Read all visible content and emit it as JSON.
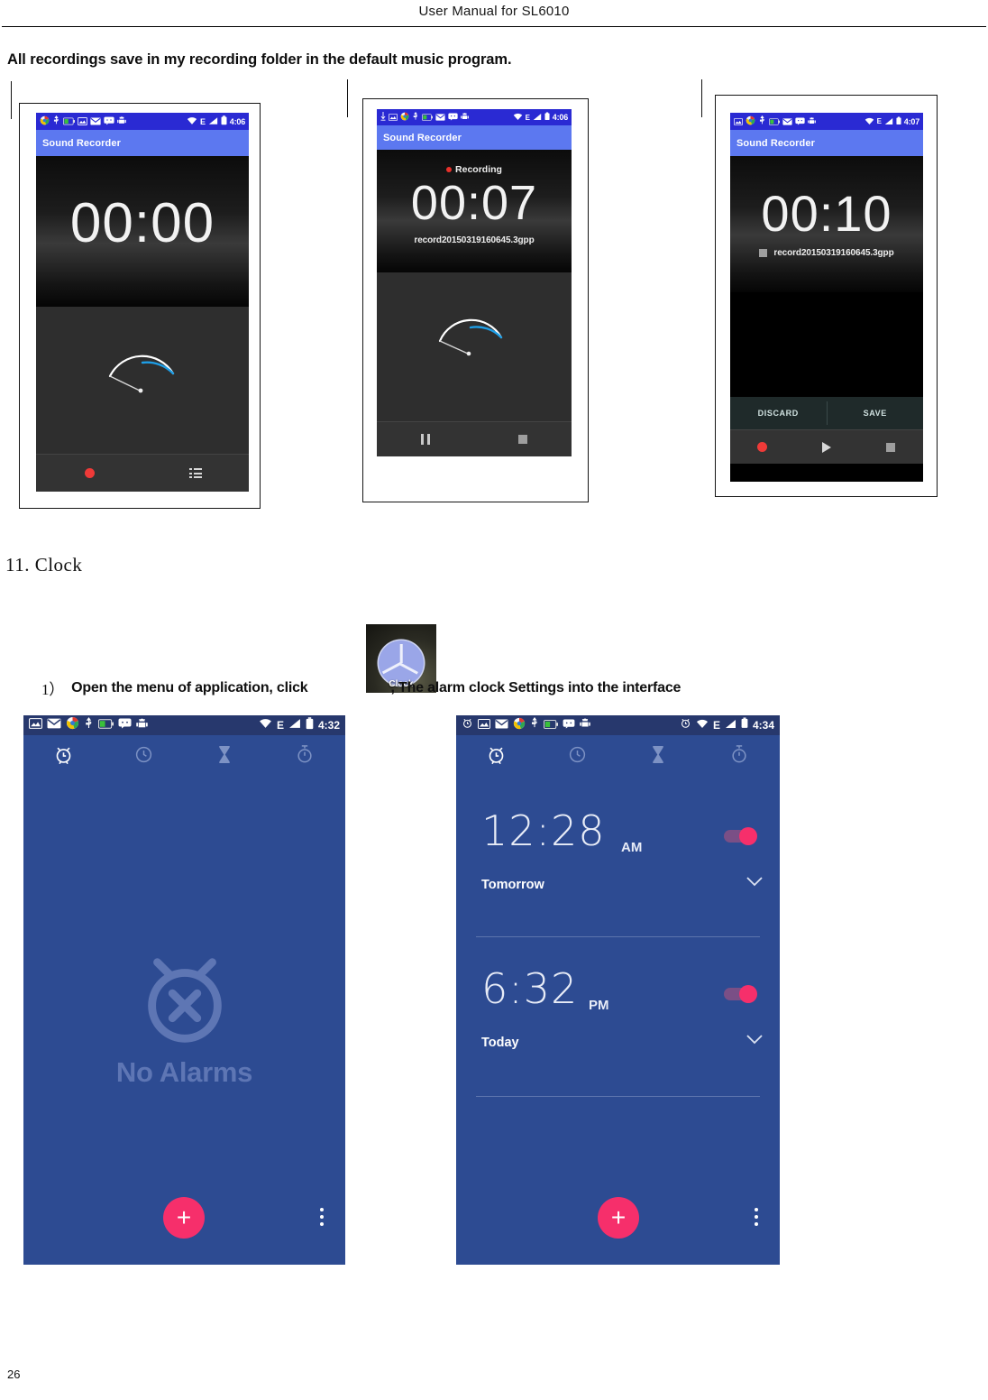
{
  "document": {
    "header_title": "User Manual for SL6010",
    "page_number": "26",
    "intro_line": "All recordings save in my recording folder in the default music program.",
    "section_heading": "11. Clock",
    "step": {
      "number": "1）",
      "text_before": "Open the menu of application, click",
      "text_after": ", The alarm clock Settings into the interface"
    },
    "clock_app_icon": {
      "label": "Clock",
      "icon": "clock-app-icon"
    }
  },
  "colors": {
    "status_bar_recorder": "#2a2ad3",
    "app_bar_recorder": "#5c78f0",
    "clock_background": "#2d4b92",
    "clock_status_bar": "#27386d",
    "accent_pink": "#f62f6b",
    "toggle_track": "#7a4f86",
    "record_red": "#ef3a38"
  },
  "recorder_screens": [
    {
      "name": "recorder-idle",
      "status_bar": {
        "time": "4:06",
        "left_icons": [
          "browser-icon",
          "usb-icon",
          "battery-charging-icon",
          "screenshot-icon",
          "email-icon",
          "sms-icon",
          "android-debug-icon"
        ],
        "right_icons": [
          "wifi-icon",
          "edge-network-icon",
          "signal-icon",
          "battery-icon"
        ]
      },
      "app_bar_title": "Sound Recorder",
      "timer": "00:00",
      "status_label": "",
      "file_name": "",
      "meter": "vu-meter",
      "bottom_buttons": [
        "record-button",
        "recording-list-button"
      ]
    },
    {
      "name": "recorder-recording",
      "status_bar": {
        "time": "4:06",
        "left_icons": [
          "download-icon",
          "screenshot-icon",
          "browser-icon",
          "usb-icon",
          "battery-charging-icon",
          "email-icon",
          "sms-icon",
          "android-debug-icon"
        ],
        "right_icons": [
          "wifi-icon",
          "edge-network-icon",
          "signal-icon",
          "battery-icon"
        ]
      },
      "app_bar_title": "Sound Recorder",
      "timer": "00:07",
      "status_label": "Recording",
      "file_name": "record20150319160645.3gpp",
      "meter": "vu-meter",
      "bottom_buttons": [
        "pause-button",
        "stop-button"
      ]
    },
    {
      "name": "recorder-saved",
      "status_bar": {
        "time": "4:07",
        "left_icons": [
          "screenshot-icon",
          "browser-icon",
          "usb-icon",
          "battery-charging-icon",
          "email-icon",
          "sms-icon",
          "android-debug-icon"
        ],
        "right_icons": [
          "wifi-icon",
          "edge-network-icon",
          "signal-icon",
          "battery-icon"
        ]
      },
      "app_bar_title": "Sound Recorder",
      "timer": "00:10",
      "status_label": "",
      "file_name": "record20150319160645.3gpp",
      "actions": [
        "DISCARD",
        "SAVE"
      ],
      "bottom_buttons": [
        "record-button",
        "play-button",
        "stop-button"
      ]
    }
  ],
  "clock_screens": [
    {
      "name": "clock-no-alarms",
      "status_bar": {
        "time": "4:32",
        "left_icons": [
          "screenshot-icon",
          "email-icon",
          "browser-icon",
          "usb-icon",
          "battery-charging-icon",
          "sms-icon",
          "android-debug-icon"
        ],
        "right_icons": [
          "wifi-icon",
          "edge-network-icon",
          "signal-icon",
          "battery-icon"
        ]
      },
      "tabs": [
        "alarm-tab",
        "clock-tab",
        "timer-tab",
        "stopwatch-tab"
      ],
      "active_tab": "alarm-tab",
      "empty_text": "No Alarms",
      "fab_label": "+",
      "alarms": []
    },
    {
      "name": "clock-with-alarms",
      "status_bar": {
        "time": "4:34",
        "left_icons": [
          "alarm-set-icon",
          "screenshot-icon",
          "email-icon",
          "browser-icon",
          "usb-icon",
          "battery-charging-icon",
          "sms-icon",
          "android-debug-icon"
        ],
        "right_icons": [
          "alarm-set-icon",
          "wifi-icon",
          "edge-network-icon",
          "signal-icon",
          "battery-icon"
        ]
      },
      "tabs": [
        "alarm-tab",
        "clock-tab",
        "timer-tab",
        "stopwatch-tab"
      ],
      "active_tab": "alarm-tab",
      "fab_label": "+",
      "alarms": [
        {
          "time": "12:28",
          "meridiem": "AM",
          "day": "Tomorrow",
          "enabled": true
        },
        {
          "time": "6:32",
          "meridiem": "PM",
          "day": "Today",
          "enabled": true
        }
      ]
    }
  ]
}
